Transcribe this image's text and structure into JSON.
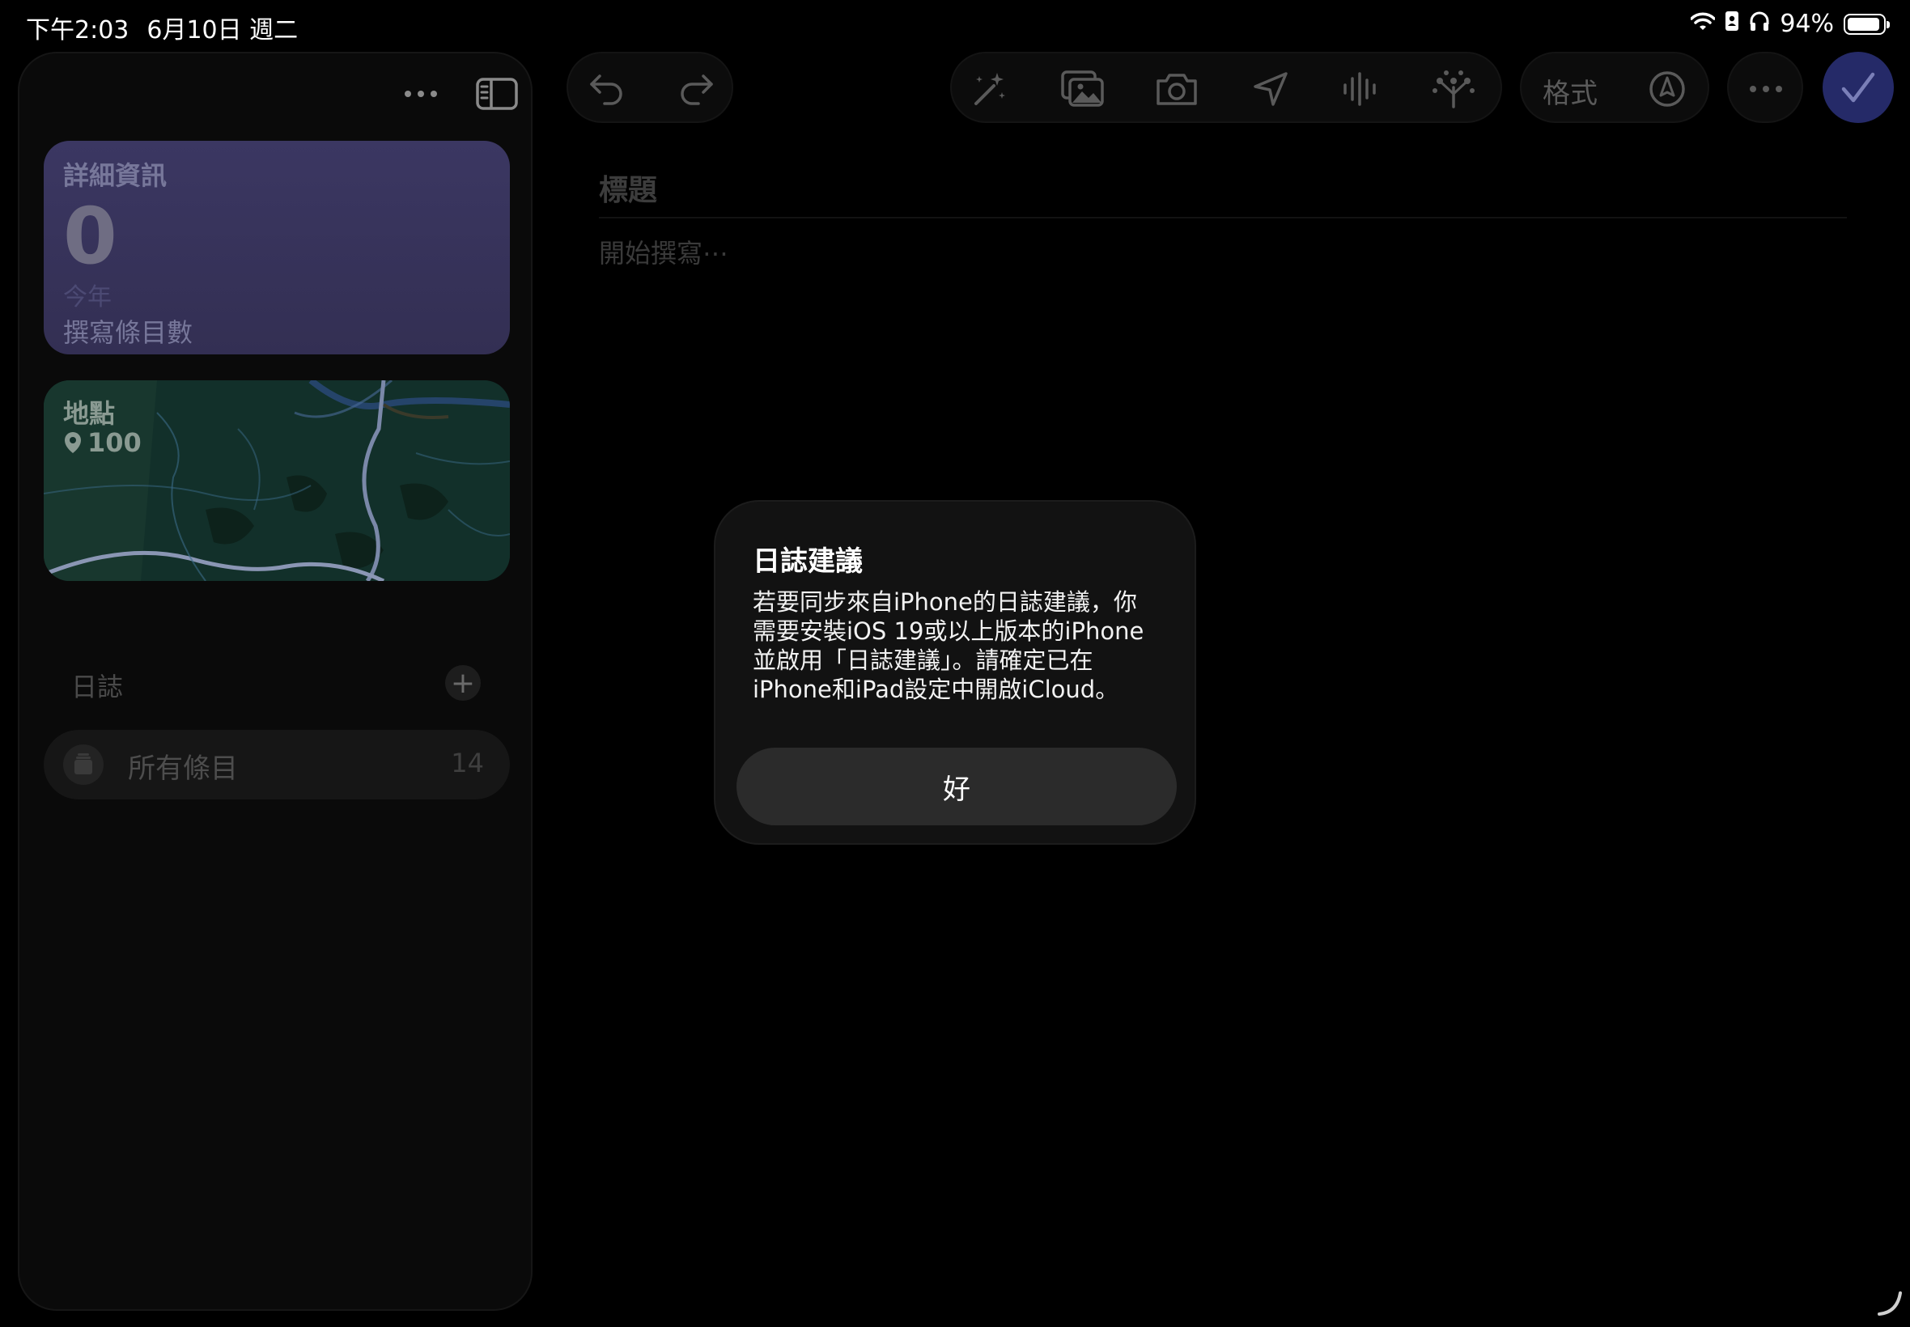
{
  "status_bar": {
    "time": "下午2:03",
    "date": "6月10日 週二",
    "battery": "94%",
    "battery_fraction": 0.94
  },
  "sidebar": {
    "more_icon": "ellipsis-icon",
    "toggle_icon": "sidebar-icon",
    "details_card": {
      "title": "詳細資訊",
      "number": "0",
      "period": "今年",
      "caption": "撰寫條目數"
    },
    "map_card": {
      "title": "地點",
      "count": "100"
    },
    "journal_section": {
      "header": "日誌",
      "add_label": "+"
    },
    "all_entries": {
      "label": "所有條目",
      "count": "14"
    }
  },
  "toolbar": {
    "format_label": "格式"
  },
  "editor": {
    "title_placeholder": "標題",
    "body_placeholder": "開始撰寫⋯"
  },
  "alert": {
    "title": "日誌建議",
    "message": "若要同步來自iPhone的日誌建議，你\n需要安裝iOS 19或以上版本的iPhone\n並啟用「日誌建議」。請確定已在\niPhone和iPad設定中開啟iCloud。",
    "ok_label": "好"
  },
  "colors": {
    "accent": "#252a68",
    "details_card": "#3b3762",
    "map_card": "#0f2a22",
    "alert_bg": "#121212"
  }
}
